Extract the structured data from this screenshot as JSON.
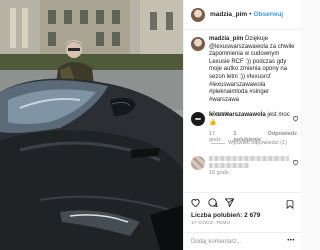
{
  "header": {
    "username": "madzia_pim",
    "separator": "•",
    "follow_label": "Obserwuj"
  },
  "caption": {
    "username": "madzia_pim",
    "text": "Dziękuje @lexuswarszawawola za chwile zapomnienia w cudownym Lexusie RCF :)) podczas gdy moje autko zmienia opony na sezon letni :)) #lexusrcf #lexuswarszawawola #pieknaimloda #singer #warszawa",
    "time": "17 godz."
  },
  "comment": {
    "username": "lexuswarszawawola",
    "text": "jest moc",
    "emoji": "👍",
    "time": "17 godz.",
    "likes": "1 polubienie",
    "reply_label": "Odpowiedz",
    "view_replies": "Wyświetl odpowiedzi (1)"
  },
  "comment2": {
    "time": "16 godz."
  },
  "actions": {
    "likes_text": "Liczba polubień: 2 679",
    "date": "17 GODZ. TEMU"
  },
  "add_comment": {
    "placeholder": "Dodaj komentarz...",
    "more_label": "•••"
  },
  "colors": {
    "accent": "#3897f0",
    "muted": "#8e8e8e"
  }
}
